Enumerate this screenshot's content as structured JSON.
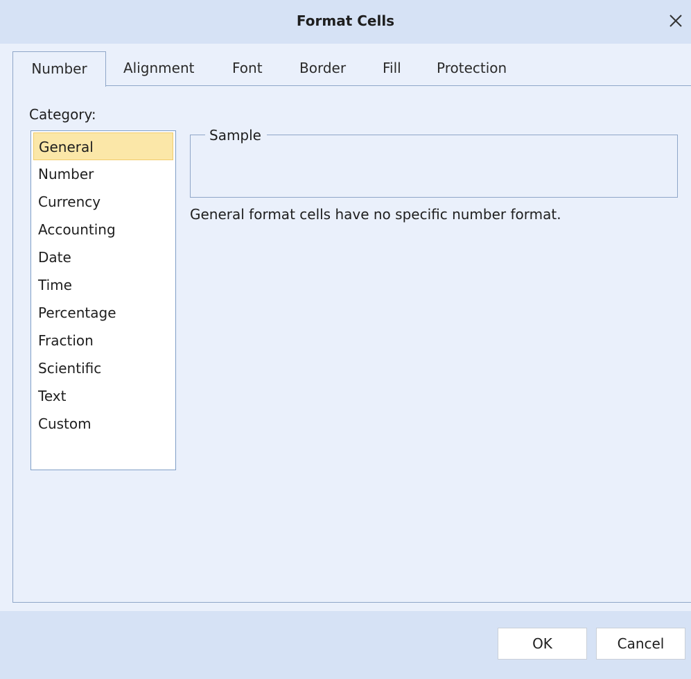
{
  "window": {
    "title": "Format Cells",
    "close_icon": "close-icon"
  },
  "tabs": [
    {
      "label": "Number",
      "active": true
    },
    {
      "label": "Alignment"
    },
    {
      "label": "Font"
    },
    {
      "label": "Border"
    },
    {
      "label": "Fill"
    },
    {
      "label": "Protection"
    }
  ],
  "number_tab": {
    "category_label": "Category:",
    "categories": [
      "General",
      "Number",
      "Currency",
      "Accounting",
      "Date",
      "Time",
      "Percentage",
      "Fraction",
      "Scientific",
      "Text",
      "Custom"
    ],
    "selected_category": "General",
    "sample_label": "Sample",
    "sample_value": "",
    "description": "General format cells have no specific number format."
  },
  "buttons": {
    "ok": "OK",
    "cancel": "Cancel"
  },
  "colors": {
    "titlebar": "#d6e2f5",
    "dialog_bg": "#eaf0fb",
    "selection": "#fbe7a8",
    "border": "#8fa6c8"
  }
}
